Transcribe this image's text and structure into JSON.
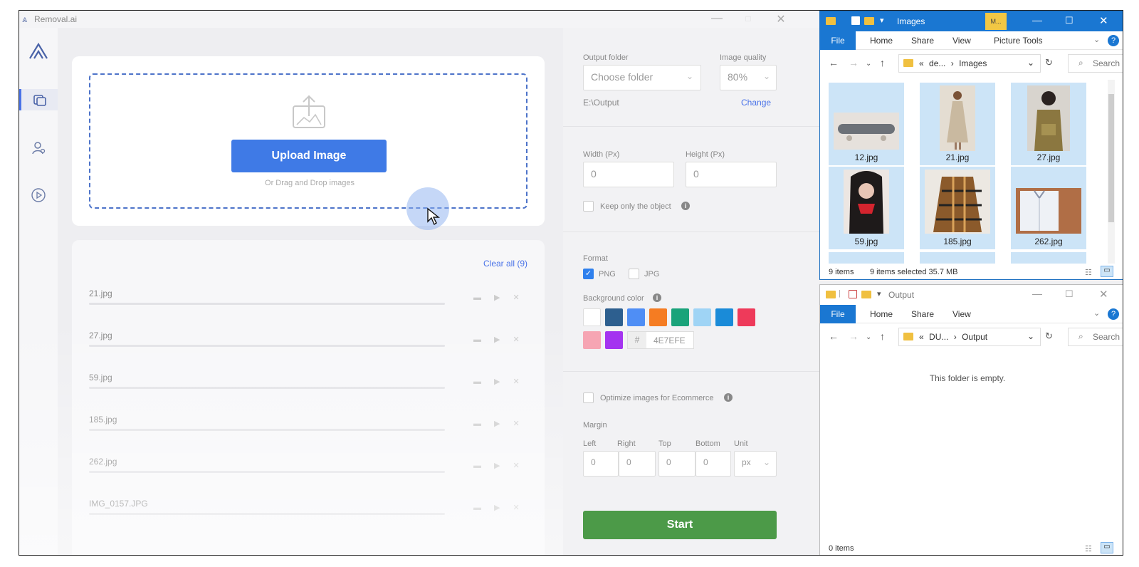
{
  "app": {
    "title": "Removal.ai",
    "window_controls": [
      "—",
      "□",
      "✕"
    ]
  },
  "sidebar": {
    "items": [
      {
        "name": "logo",
        "icon": "removal-logo-icon"
      },
      {
        "name": "batch",
        "icon": "layers-icon",
        "active": true
      },
      {
        "name": "account",
        "icon": "user-icon"
      },
      {
        "name": "tutorial",
        "icon": "play-icon"
      }
    ]
  },
  "upload": {
    "button_label": "Upload Image",
    "hint": "Or Drag and Drop images"
  },
  "file_list": {
    "clear_label": "Clear all (9)",
    "files": [
      "21.jpg",
      "27.jpg",
      "59.jpg",
      "185.jpg",
      "262.jpg",
      "IMG_0157.JPG"
    ]
  },
  "settings": {
    "output_folder_label": "Output folder",
    "output_folder_placeholder": "Choose folder",
    "image_quality_label": "Image quality",
    "image_quality_value": "80%",
    "output_path": "E:\\Output",
    "change_label": "Change",
    "width_label": "Width (Px)",
    "width_value": "0",
    "height_label": "Height (Px)",
    "height_value": "0",
    "keep_object_label": "Keep only the object",
    "format_label": "Format",
    "format_png": "PNG",
    "format_jpg": "JPG",
    "png_checked": true,
    "jpg_checked": false,
    "bg_color_label": "Background color",
    "bg_colors": [
      "#ffffff",
      "#2d5f8f",
      "#4f8ef5",
      "#f57c22",
      "#1aa37a",
      "#9fd4f5",
      "#1a8bd8",
      "#ee3a5a",
      "#f6a5b3",
      "#a433f0"
    ],
    "hash_symbol": "#",
    "hex_value": "4E7EFE",
    "optimize_label": "Optimize images for Ecommerce",
    "margin_label": "Margin",
    "margin_left_label": "Left",
    "margin_right_label": "Right",
    "margin_top_label": "Top",
    "margin_bottom_label": "Bottom",
    "margin_unit_label": "Unit",
    "margin_left": "0",
    "margin_right": "0",
    "margin_top": "0",
    "margin_bottom": "0",
    "margin_unit": "px",
    "start_label": "Start"
  },
  "explorer_images": {
    "title": "Images",
    "tool_badge": "M...",
    "tabs": [
      "File",
      "Home",
      "Share",
      "View",
      "Picture Tools"
    ],
    "path_parent": "de...",
    "path_current": "Images",
    "path_prefix": "«",
    "search_placeholder": "Search",
    "thumbnails": [
      "12.jpg",
      "21.jpg",
      "27.jpg",
      "59.jpg",
      "185.jpg",
      "262.jpg"
    ],
    "status_items": "9 items",
    "status_selected": "9 items selected  35.7 MB"
  },
  "explorer_output": {
    "title": "Output",
    "tabs": [
      "File",
      "Home",
      "Share",
      "View"
    ],
    "path_parent": "DU...",
    "path_current": "Output",
    "path_prefix": "«",
    "search_placeholder": "Search",
    "empty_message": "This folder is empty.",
    "status_items": "0 items"
  }
}
